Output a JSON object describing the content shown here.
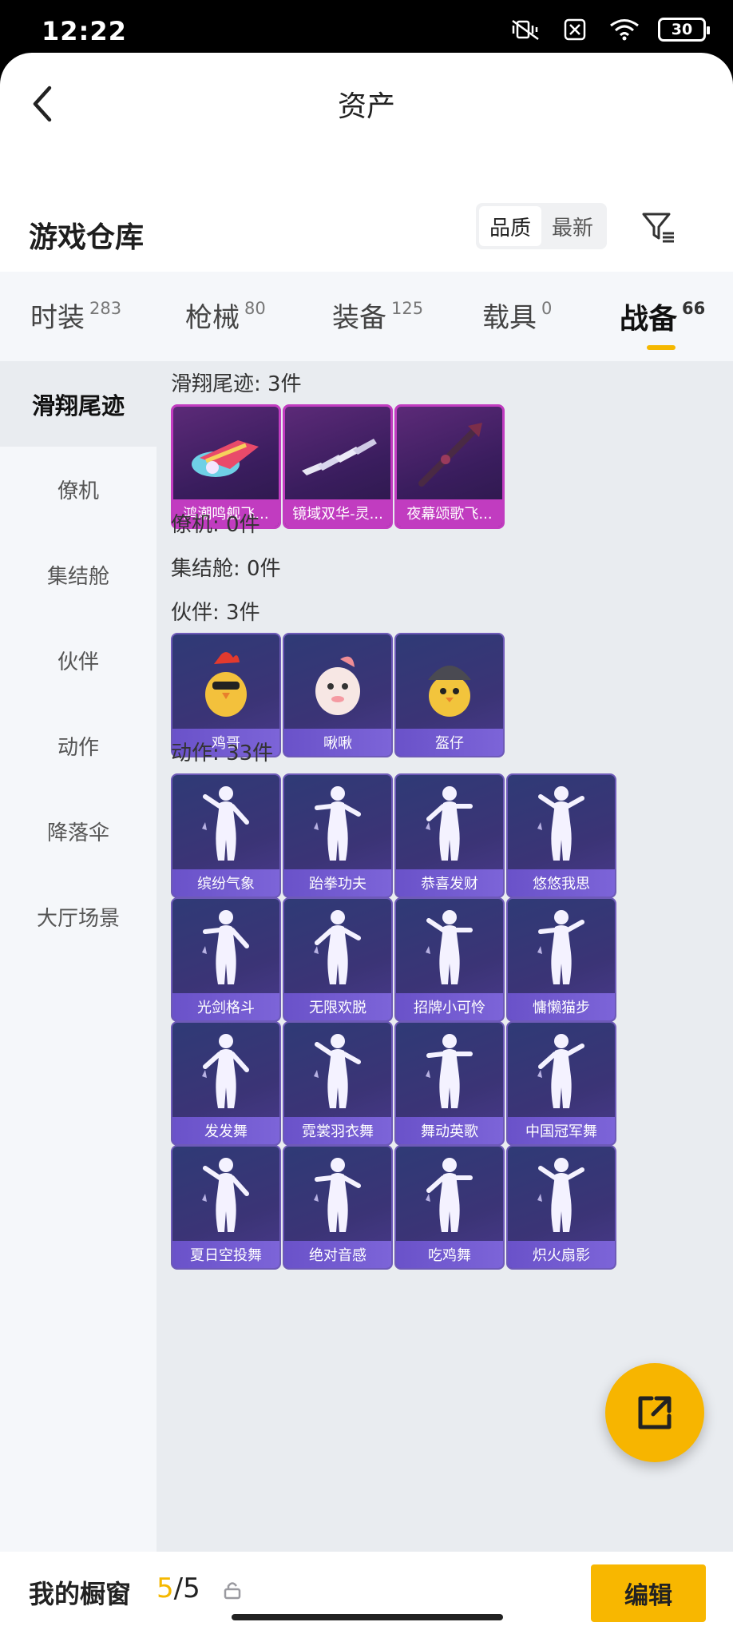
{
  "status_bar": {
    "time": "12:22",
    "battery": "30"
  },
  "header": {
    "title": "资产"
  },
  "warehouse": {
    "title": "游戏仓库",
    "sort_options": [
      {
        "label": "品质",
        "active": true
      },
      {
        "label": "最新",
        "active": false
      }
    ]
  },
  "tabs": [
    {
      "label": "时装",
      "count": "283",
      "active": false
    },
    {
      "label": "枪械",
      "count": "80",
      "active": false
    },
    {
      "label": "装备",
      "count": "125",
      "active": false
    },
    {
      "label": "载具",
      "count": "0",
      "active": false
    },
    {
      "label": "战备",
      "count": "66",
      "active": true
    }
  ],
  "sidebar": [
    {
      "label": "滑翔尾迹",
      "active": true
    },
    {
      "label": "僚机",
      "active": false
    },
    {
      "label": "集结舱",
      "active": false
    },
    {
      "label": "伙伴",
      "active": false
    },
    {
      "label": "动作",
      "active": false
    },
    {
      "label": "降落伞",
      "active": false
    },
    {
      "label": "大厅场景",
      "active": false
    }
  ],
  "sections": {
    "glide": {
      "title": "滑翔尾迹: 3件",
      "items": [
        "鸿潮鸣舰飞...",
        "镜域双华-灵...",
        "夜幕颂歌飞..."
      ]
    },
    "wingman": {
      "title": "僚机: 0件"
    },
    "pod": {
      "title": "集结舱: 0件"
    },
    "partner": {
      "title": "伙伴: 3件",
      "items": [
        "鸡哥",
        "啾啾",
        "盔仔"
      ]
    },
    "emote": {
      "title": "动作: 33件",
      "items": [
        "缤纷气象",
        "跆拳功夫",
        "恭喜发财",
        "悠悠我思",
        "光剑格斗",
        "无限欢脱",
        "招牌小可怜",
        "慵懒猫步",
        "发发舞",
        "霓裳羽衣舞",
        "舞动英歌",
        "中国冠军舞",
        "夏日空投舞",
        "绝对音感",
        "吃鸡舞",
        "炽火扇影"
      ]
    }
  },
  "bottom": {
    "showcase_label": "我的橱窗",
    "current": "5",
    "total": "/5",
    "edit_label": "编辑"
  },
  "colors": {
    "accent": "#f5b800",
    "rare_pink": "#c13cc0",
    "card_violet": "#6a52c9"
  }
}
